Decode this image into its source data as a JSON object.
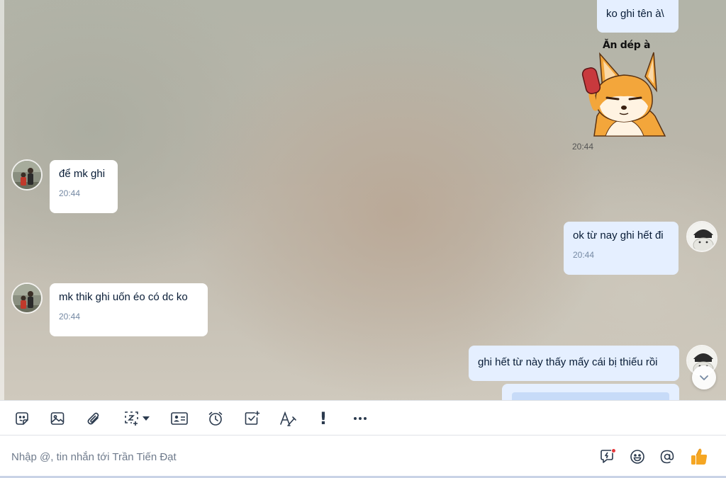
{
  "messages": [
    {
      "id": "m1",
      "direction": "out",
      "text": "ko ghi tên à\\"
    },
    {
      "id": "m2",
      "direction": "out",
      "type": "sticker",
      "sticker_caption": "Ăn dép à",
      "time": "20:44"
    },
    {
      "id": "m3",
      "direction": "in",
      "text": "để mk ghi",
      "time": "20:44"
    },
    {
      "id": "m4",
      "direction": "out",
      "text": "ok từ nay ghi hết đi",
      "time": "20:44"
    },
    {
      "id": "m5",
      "direction": "in",
      "text": "mk thik ghi uốn éo có dc ko",
      "time": "20:44"
    },
    {
      "id": "m6",
      "direction": "out",
      "text": "ghi hết từ này thấy mấy cái bị thiếu rồi"
    }
  ],
  "toolbar": {
    "items": [
      "sticker-icon",
      "image-icon",
      "attachment-icon",
      "screenshot-icon",
      "contact-card-icon",
      "reminder-icon",
      "task-icon",
      "text-format-icon",
      "urgent-icon",
      "more-icon"
    ],
    "urgent_label": "!"
  },
  "composer": {
    "placeholder": "Nhập @, tin nhắn tới Trần Tiến Đạt",
    "value": "",
    "icons": [
      "quick-reply-icon",
      "emoji-icon",
      "mention-icon",
      "thumbs-up-icon"
    ]
  },
  "colors": {
    "outgoing_bubble": "#e5efff",
    "incoming_bubble": "#ffffff",
    "time_text": "#7589a3",
    "thumbs_up": "#f5a623"
  }
}
